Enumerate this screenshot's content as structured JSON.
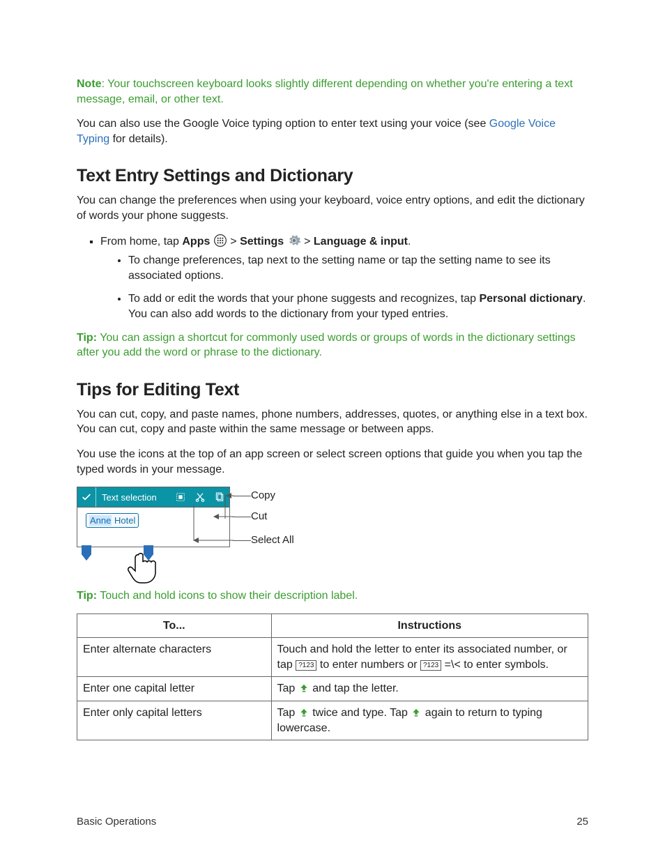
{
  "note": {
    "label": "Note",
    "text": ": Your touchscreen keyboard looks slightly different depending on whether you're entering a text message, email, or other text."
  },
  "para_voice_pre": "You can also use the Google Voice typing option to enter text using your voice (see ",
  "para_voice_link": "Google Voice Typing",
  "para_voice_post": " for details).",
  "h_text_entry": "Text Entry Settings and Dictionary",
  "p_text_entry": "You can change the preferences when using your keyboard, voice entry options, and edit the dictionary of words your phone suggests.",
  "steps": {
    "from_home_pre": "From home, tap ",
    "apps": "Apps",
    "gt1": " > ",
    "settings": "Settings",
    "gt2": " > ",
    "lang_input": "Language & input",
    "dot": ".",
    "sub1": "To change preferences, tap next to the setting name or tap the setting name to see its associated options.",
    "sub2_pre": "To add or edit the words that your phone suggests and recognizes, tap ",
    "sub2_bold": "Personal dictionary",
    "sub2_post": ". You can also add words to the dictionary from your typed entries."
  },
  "tip1": {
    "label": "Tip:",
    "text": " You can assign a shortcut for commonly used words or groups of words in the dictionary settings after you add the word or phrase to the dictionary."
  },
  "h_tips": "Tips for Editing Text",
  "p_tips1": "You can cut, copy, and paste names, phone numbers, addresses, quotes, or anything else in a text box. You can cut, copy and paste within the same message or between apps.",
  "p_tips2": "You use the icons at the top of an app screen or select screen options that guide you when you tap the typed words in your message.",
  "diagram": {
    "bar_label": "Text selection",
    "pill_sel": "Anne",
    "pill_rest": " Hotel",
    "copy": "Copy",
    "cut": "Cut",
    "selectall": "Select All"
  },
  "tip2": {
    "label": "Tip:",
    "text": " Touch and hold icons to show their description label."
  },
  "table": {
    "h1": "To...",
    "h2": "Instructions",
    "r1c1": "Enter alternate characters",
    "r1c2a": "Touch and hold the letter to enter its associated number, or tap ",
    "r1c2b": " to enter numbers or ",
    "r1c2c": " =\\< to enter symbols.",
    "key123": "?123",
    "r2c1": "Enter one capital letter",
    "r2c2a": "Tap ",
    "r2c2b": " and tap the letter.",
    "r3c1": "Enter only capital letters",
    "r3c2a": "Tap ",
    "r3c2b": " twice and type. Tap ",
    "r3c2c": " again to return to typing lowercase."
  },
  "footer": {
    "section": "Basic Operations",
    "page": "25"
  }
}
